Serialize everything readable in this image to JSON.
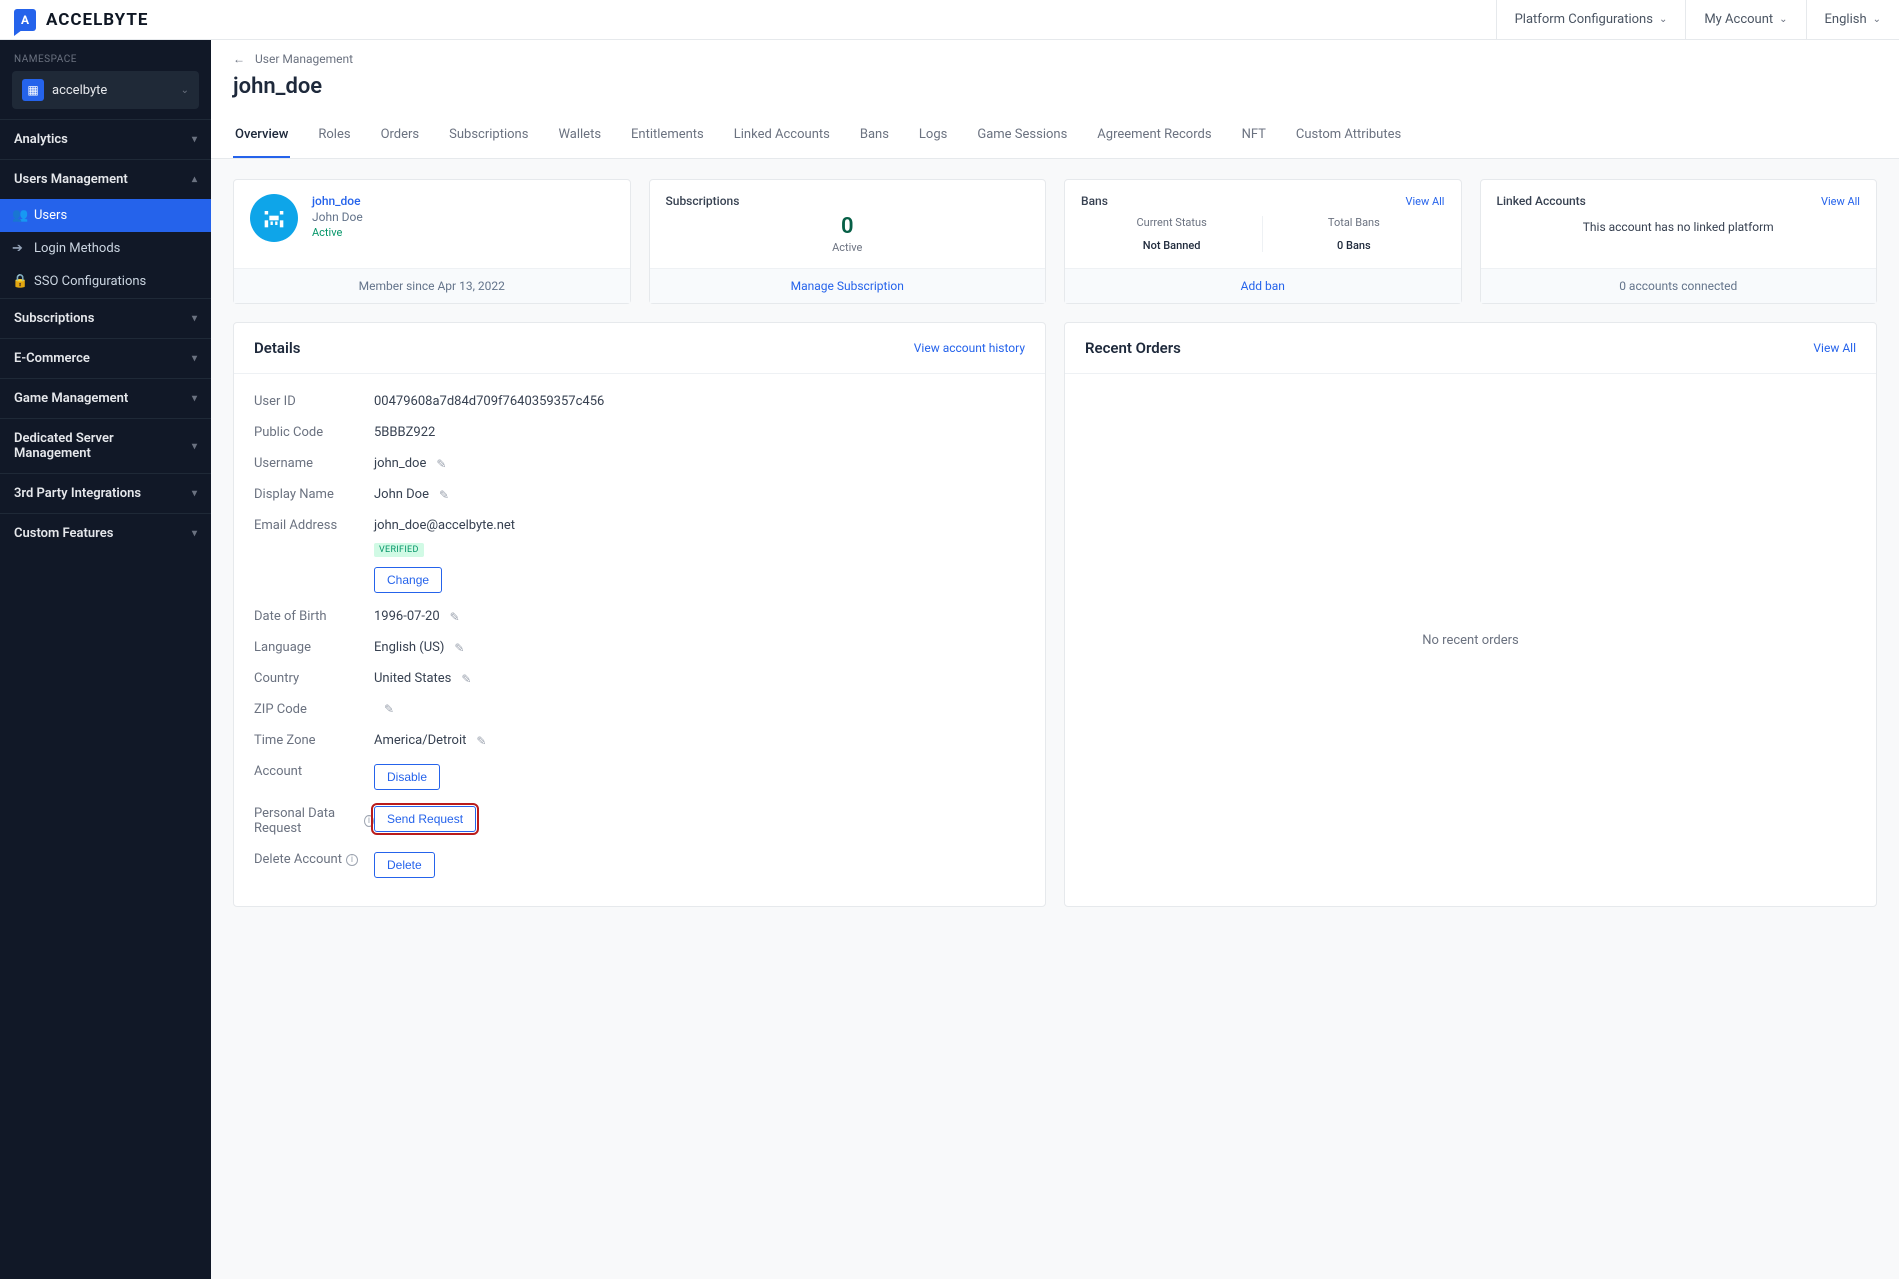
{
  "brand": "ACCELBYTE",
  "header": {
    "platformConfigs": "Platform Configurations",
    "myAccount": "My Account",
    "language": "English"
  },
  "sidebar": {
    "nsLabel": "NAMESPACE",
    "nsName": "accelbyte",
    "sections": {
      "analytics": "Analytics",
      "usersManagement": "Users Management",
      "subscriptions": "Subscriptions",
      "ecommerce": "E-Commerce",
      "gameManagement": "Game Management",
      "dedicatedServer": "Dedicated Server Management",
      "thirdParty": "3rd Party Integrations",
      "customFeatures": "Custom Features"
    },
    "usersSub": {
      "users": "Users",
      "loginMethods": "Login Methods",
      "sso": "SSO Configurations"
    }
  },
  "breadcrumb": "User Management",
  "pageTitle": "john_doe",
  "tabs": [
    "Overview",
    "Roles",
    "Orders",
    "Subscriptions",
    "Wallets",
    "Entitlements",
    "Linked Accounts",
    "Bans",
    "Logs",
    "Game Sessions",
    "Agreement Records",
    "NFT",
    "Custom Attributes"
  ],
  "profileCard": {
    "username": "john_doe",
    "displayName": "John Doe",
    "status": "Active",
    "memberSince": "Member since Apr 13, 2022"
  },
  "subsCard": {
    "title": "Subscriptions",
    "value": "0",
    "label": "Active",
    "action": "Manage Subscription"
  },
  "bansCard": {
    "title": "Bans",
    "viewAll": "View All",
    "currentStatusLabel": "Current Status",
    "currentStatusValue": "Not Banned",
    "totalBansLabel": "Total Bans",
    "totalBansValue": "0 Bans",
    "action": "Add ban"
  },
  "linkedCard": {
    "title": "Linked Accounts",
    "viewAll": "View All",
    "body": "This account has no linked platform",
    "footer": "0 accounts connected"
  },
  "detailsPanel": {
    "title": "Details",
    "historyLink": "View account history",
    "rows": {
      "userIdLabel": "User ID",
      "userIdValue": "00479608a7d84d709f7640359357c456",
      "publicCodeLabel": "Public Code",
      "publicCodeValue": "5BBBZ922",
      "usernameLabel": "Username",
      "usernameValue": "john_doe",
      "displayNameLabel": "Display Name",
      "displayNameValue": "John Doe",
      "emailLabel": "Email Address",
      "emailValue": "john_doe@accelbyte.net",
      "verified": "VERIFIED",
      "changeBtn": "Change",
      "dobLabel": "Date of Birth",
      "dobValue": "1996-07-20",
      "languageLabel": "Language",
      "languageValue": "English (US)",
      "countryLabel": "Country",
      "countryValue": "United States",
      "zipLabel": "ZIP Code",
      "zipValue": "",
      "tzLabel": "Time Zone",
      "tzValue": "America/Detroit",
      "accountLabel": "Account",
      "disableBtn": "Disable",
      "pdrLabel": "Personal Data Request",
      "sendRequestBtn": "Send Request",
      "deleteLabel": "Delete Account",
      "deleteBtn": "Delete"
    }
  },
  "ordersPanel": {
    "title": "Recent Orders",
    "viewAll": "View All",
    "empty": "No recent orders"
  }
}
